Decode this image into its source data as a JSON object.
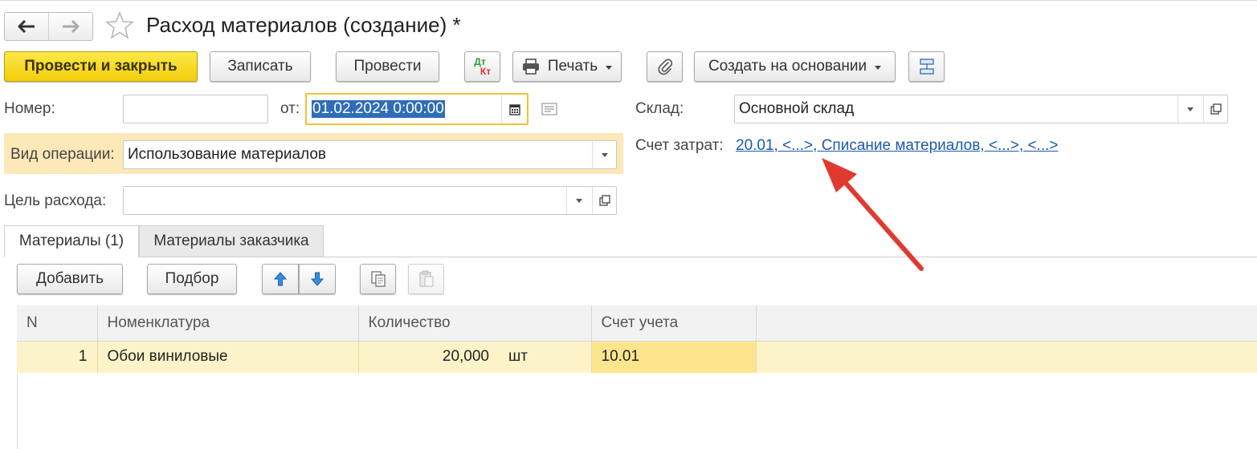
{
  "window": {
    "title": "Расход материалов (создание) *",
    "nav_back_icon": "arrow-left-icon",
    "nav_forward_icon": "arrow-right-icon",
    "favorite_icon": "star-icon"
  },
  "toolbar": {
    "post_close_label": "Провести и закрыть",
    "save_label": "Записать",
    "post_label": "Провести",
    "dt_label": "Дт",
    "kt_label": "Кт",
    "print_label": "Печать",
    "attach_icon": "paperclip-icon",
    "create_based_label": "Создать на основании",
    "structure_icon": "structure-icon"
  },
  "form": {
    "number_label": "Номер:",
    "number_value": "",
    "date_label": "от:",
    "date_value": "01.02.2024  0:00:00",
    "warehouse_label": "Склад:",
    "warehouse_value": "Основной склад",
    "operation_label": "Вид операции:",
    "operation_value": "Использование материалов",
    "cost_account_label": "Счет затрат:",
    "cost_account_value": "20.01, <...>, Списание материалов, <...>, <...>",
    "purpose_label": "Цель расхода:",
    "purpose_value": ""
  },
  "tabs": [
    {
      "label": "Материалы (1)",
      "active": true
    },
    {
      "label": "Материалы заказчика",
      "active": false
    }
  ],
  "table_toolbar": {
    "add_label": "Добавить",
    "pick_label": "Подбор"
  },
  "table": {
    "columns": [
      "N",
      "Номенклатура",
      "Количество",
      "Счет учета"
    ],
    "rows": [
      {
        "n": "1",
        "item": "Обои виниловые",
        "qty": "20,000",
        "unit": "шт",
        "account": "10.01"
      }
    ]
  },
  "colors": {
    "primary_button": "#f5d313",
    "highlight_bg": "#fde8b8",
    "row_selected": "#fdf3c8",
    "link": "#1d5aa8",
    "annotation_arrow": "#e03a30"
  }
}
